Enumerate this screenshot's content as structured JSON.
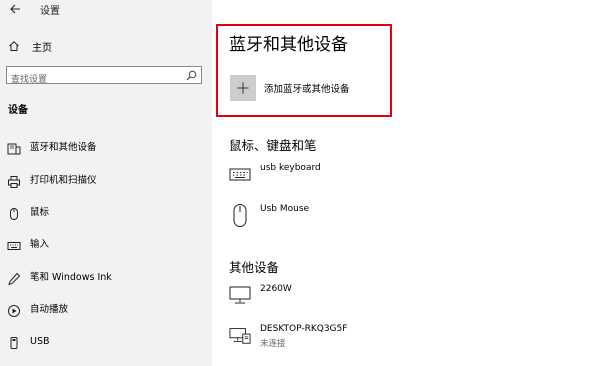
{
  "window": {
    "title": "设置"
  },
  "sidebar": {
    "home": "主页",
    "search_placeholder": "查找设置",
    "section": "设备",
    "items": [
      {
        "label": "蓝牙和其他设备",
        "icon": "bluetooth-devices-icon"
      },
      {
        "label": "打印机和扫描仪",
        "icon": "printer-icon"
      },
      {
        "label": "鼠标",
        "icon": "mouse-icon"
      },
      {
        "label": "输入",
        "icon": "keyboard-icon"
      },
      {
        "label": "笔和 Windows Ink",
        "icon": "pen-icon"
      },
      {
        "label": "自动播放",
        "icon": "autoplay-icon"
      },
      {
        "label": "USB",
        "icon": "usb-icon"
      }
    ]
  },
  "main": {
    "title": "蓝牙和其他设备",
    "add_device_label": "添加蓝牙或其他设备",
    "groups": [
      {
        "title": "鼠标、键盘和笔",
        "devices": [
          {
            "name": "usb keyboard",
            "icon": "keyboard-icon"
          },
          {
            "name": "Usb Mouse",
            "icon": "mouse-icon"
          }
        ]
      },
      {
        "title": "其他设备",
        "devices": [
          {
            "name": "2260W",
            "icon": "monitor-icon"
          },
          {
            "name": "DESKTOP-RKQ3G5F",
            "status": "未连接",
            "icon": "network-computer-icon"
          }
        ]
      }
    ]
  },
  "colors": {
    "sidebar_bg": "#f2f2f2",
    "highlight_border": "#e00012",
    "plus_bg": "#cccccc"
  }
}
